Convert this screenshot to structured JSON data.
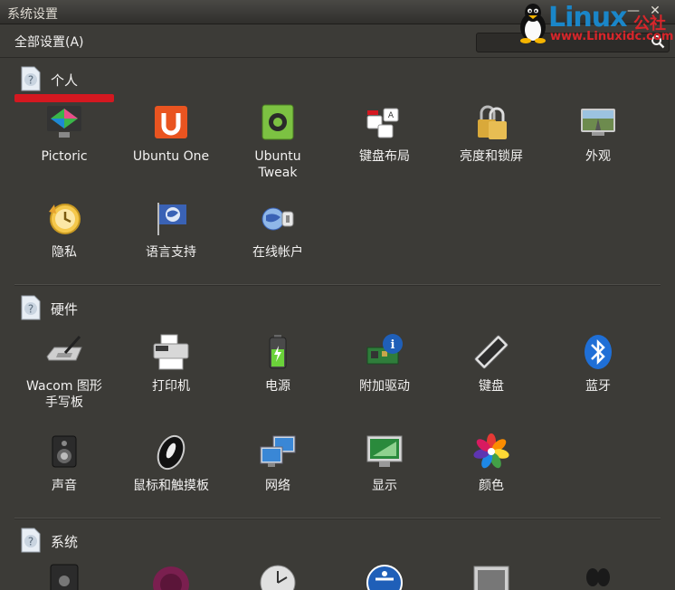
{
  "window": {
    "title": "系统设置",
    "close_glyph": "✕",
    "min_glyph": "—"
  },
  "menubar": {
    "all_settings": "全部设置(A)"
  },
  "search": {
    "placeholder": ""
  },
  "logo": {
    "main": "Linux",
    "suffix": "公社",
    "url": "www.Linuxidc.com"
  },
  "sections": [
    {
      "title": "个人",
      "items": [
        {
          "label": "Pictoric",
          "icon": "pictoric-icon"
        },
        {
          "label": "Ubuntu One",
          "icon": "ubuntu-one-icon"
        },
        {
          "label": "Ubuntu\nTweak",
          "icon": "ubuntu-tweak-icon"
        },
        {
          "label": "键盘布局",
          "icon": "keyboard-layout-icon"
        },
        {
          "label": "亮度和锁屏",
          "icon": "brightness-lock-icon"
        },
        {
          "label": "外观",
          "icon": "appearance-icon"
        },
        {
          "label": "隐私",
          "icon": "privacy-icon"
        },
        {
          "label": "语言支持",
          "icon": "language-icon"
        },
        {
          "label": "在线帐户",
          "icon": "online-accounts-icon"
        }
      ]
    },
    {
      "title": "硬件",
      "items": [
        {
          "label": "Wacom 图形\n手写板",
          "icon": "wacom-tablet-icon"
        },
        {
          "label": "打印机",
          "icon": "printer-icon"
        },
        {
          "label": "电源",
          "icon": "power-icon"
        },
        {
          "label": "附加驱动",
          "icon": "additional-drivers-icon"
        },
        {
          "label": "键盘",
          "icon": "keyboard-icon"
        },
        {
          "label": "蓝牙",
          "icon": "bluetooth-icon"
        },
        {
          "label": "声音",
          "icon": "sound-icon"
        },
        {
          "label": "鼠标和触摸板",
          "icon": "mouse-touchpad-icon"
        },
        {
          "label": "网络",
          "icon": "network-icon"
        },
        {
          "label": "显示",
          "icon": "display-icon"
        },
        {
          "label": "颜色",
          "icon": "color-icon"
        }
      ]
    },
    {
      "title": "系统",
      "items": []
    }
  ],
  "colors": {
    "accent_red": "#d41820",
    "background": "#3c3b37",
    "logo_blue": "#1a86c8"
  }
}
